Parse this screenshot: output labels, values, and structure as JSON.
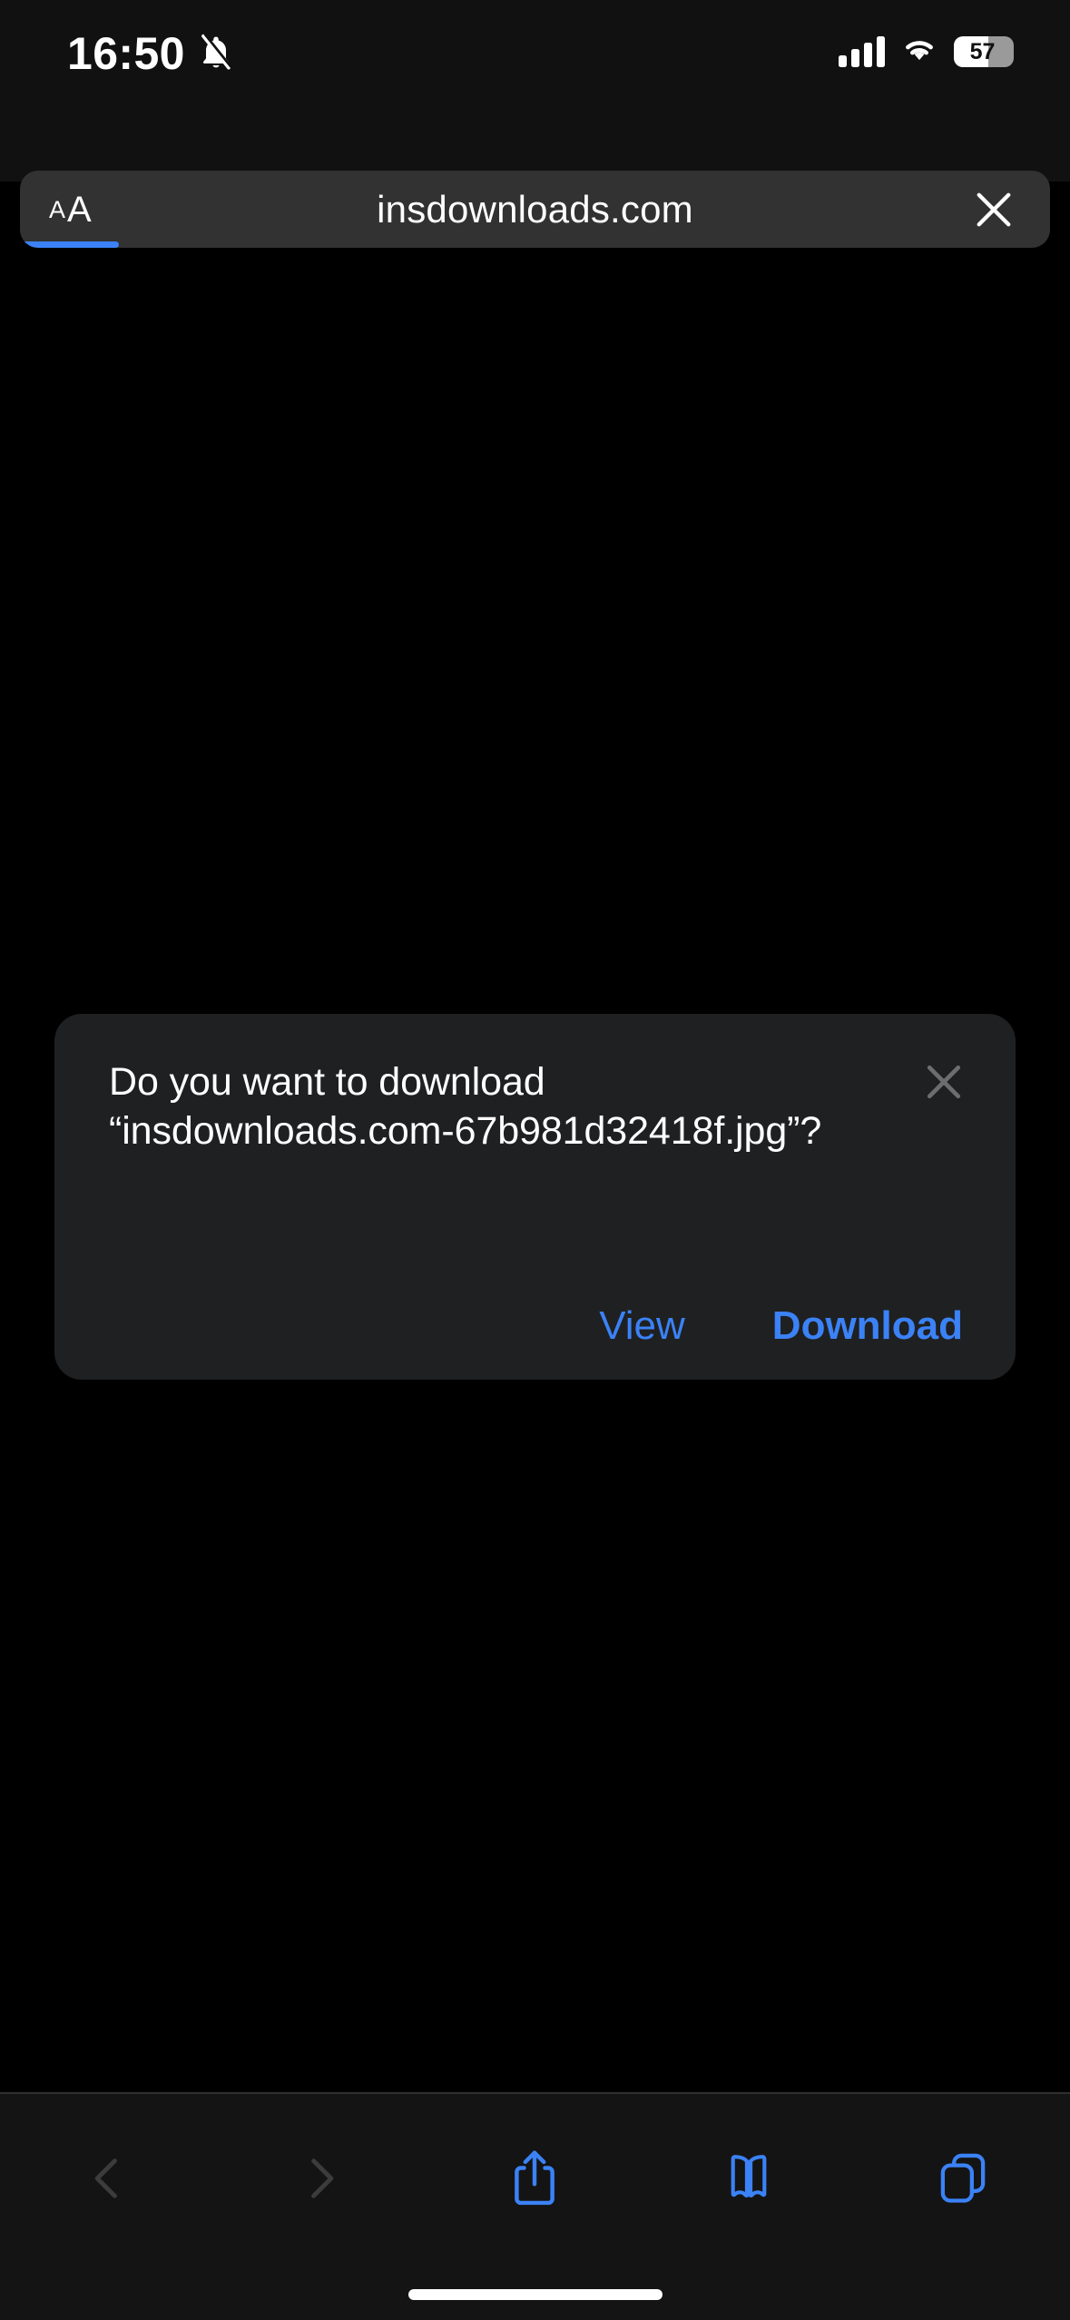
{
  "status_bar": {
    "time": "16:50",
    "mute_icon": "bell-slash-icon",
    "signal_icon": "cellular-bars-icon",
    "wifi_icon": "wifi-icon",
    "battery_percent": "57",
    "battery_level": 57
  },
  "browser": {
    "url": "insdownloads.com",
    "text_size_small": "A",
    "text_size_large": "A",
    "text_size_name": "text-size-button",
    "stop_icon": "close-icon",
    "loading_progress": 10
  },
  "dialog": {
    "message": "Do you want to download “insdownloads.com-67b981d32418f.jpg”?",
    "filename": "insdownloads.com-67b981d32418f.jpg",
    "close_icon": "close-icon",
    "view_label": "View",
    "download_label": "Download"
  },
  "toolbar": {
    "back_icon": "chevron-left-icon",
    "forward_icon": "chevron-right-icon",
    "share_icon": "share-icon",
    "bookmarks_icon": "book-icon",
    "tabs_icon": "tabs-icon"
  },
  "colors": {
    "accent_blue": "#3b82f6",
    "disabled_gray": "#3c3c3c",
    "dialog_bg": "#1f2022",
    "page_bg": "#000000",
    "chrome_bg": "#111111"
  }
}
